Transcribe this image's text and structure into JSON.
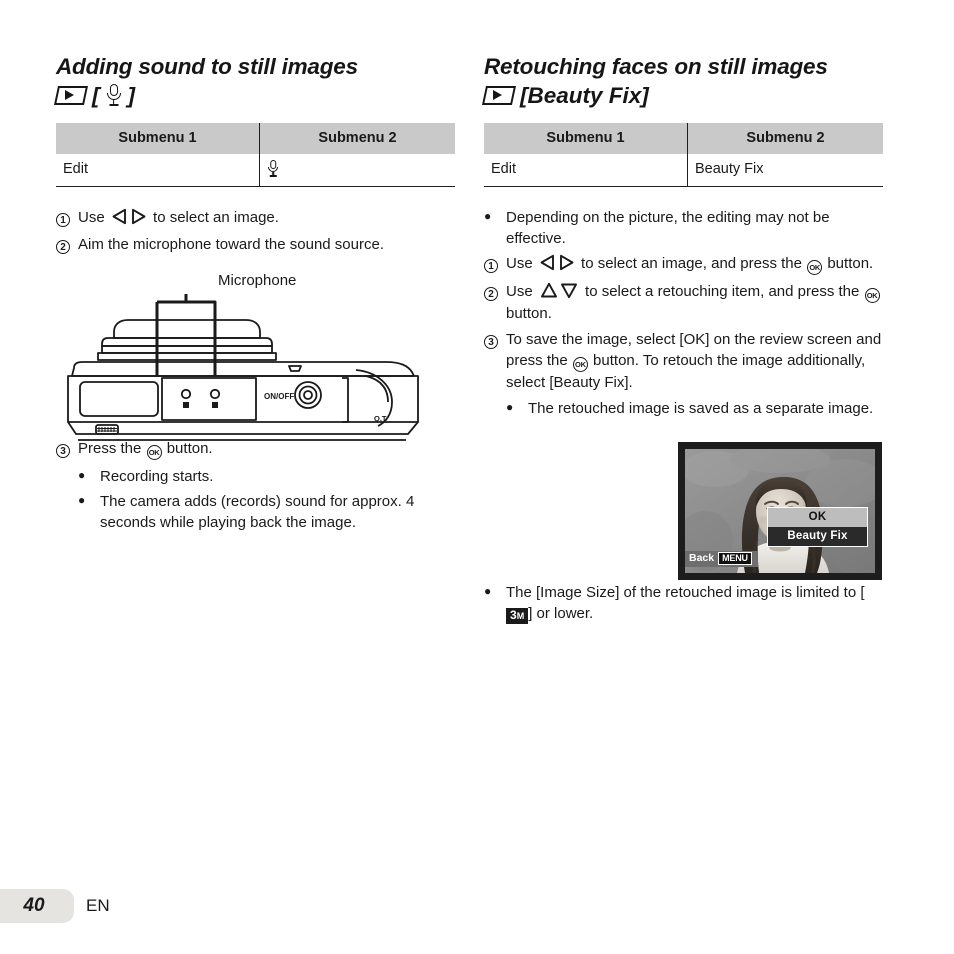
{
  "document": {
    "page_number": "40",
    "language_code": "EN"
  },
  "left_column": {
    "title": "Adding sound to still images",
    "title_icons": {
      "playback": "playback-icon",
      "open_bracket": "[",
      "mic": "microphone-icon",
      "close_bracket": "]"
    },
    "table": {
      "headers": [
        "Submenu 1",
        "Submenu 2"
      ],
      "rows": [
        {
          "submenu1": "Edit",
          "submenu2_icon": "microphone-icon"
        }
      ]
    },
    "steps": [
      {
        "number": "1",
        "text_before": "Use",
        "icons": "left-right-arrows",
        "text_after": "to select an image."
      },
      {
        "number": "2",
        "text_before": "Aim the microphone toward the sound source.",
        "icons": "",
        "text_after": ""
      }
    ],
    "figure": {
      "label": "Microphone",
      "camera_labels": [
        "ON/OFF",
        "Q.T"
      ]
    },
    "step3": {
      "number": "3",
      "text_before": "Press the",
      "button": "OK",
      "text_after": "button."
    },
    "bullets": [
      "Recording starts.",
      "The camera adds (records) sound for approx. 4 seconds while playing back the image."
    ]
  },
  "right_column": {
    "title": "Retouching faces on still images",
    "title_bracket_text": "[Beauty Fix]",
    "table": {
      "headers": [
        "Submenu 1",
        "Submenu 2"
      ],
      "rows": [
        {
          "submenu1": "Edit",
          "submenu2": "Beauty Fix"
        }
      ]
    },
    "intro_bullet": "Depending on the picture, the editing may not be effective.",
    "step1": {
      "number": "1",
      "text_before": "Use",
      "icons": "left-right-arrows",
      "text_mid": "to select an image, and press the",
      "button": "OK",
      "text_after": "button."
    },
    "step2": {
      "number": "2",
      "text_before": "Use",
      "icons": "up-down-arrows",
      "text_mid": "to select a retouching item, and press the",
      "button": "OK",
      "text_after": "button."
    },
    "step3": {
      "number": "3",
      "text_before": "To save the image, select [OK] on the review screen and press the",
      "button": "OK",
      "text_after": "button. To retouch the image additionally, select [Beauty Fix]."
    },
    "step3_bullet": "The retouched image is saved as a separate image.",
    "screen": {
      "menu_ok": "OK",
      "menu_beauty_fix": "Beauty Fix",
      "back_label": "Back",
      "menu_badge": "MENU"
    },
    "final_bullet": {
      "text_before": "The [Image Size] of the retouched image is limited to [",
      "badge_number": "3",
      "badge_unit": "M",
      "text_after": "] or lower."
    }
  },
  "colors": {
    "table_header_bg": "#c9c9c9",
    "text": "#1a1a1a",
    "footer_tab_bg": "#e6e4e1",
    "screen_frame": "#1d1d1d"
  }
}
